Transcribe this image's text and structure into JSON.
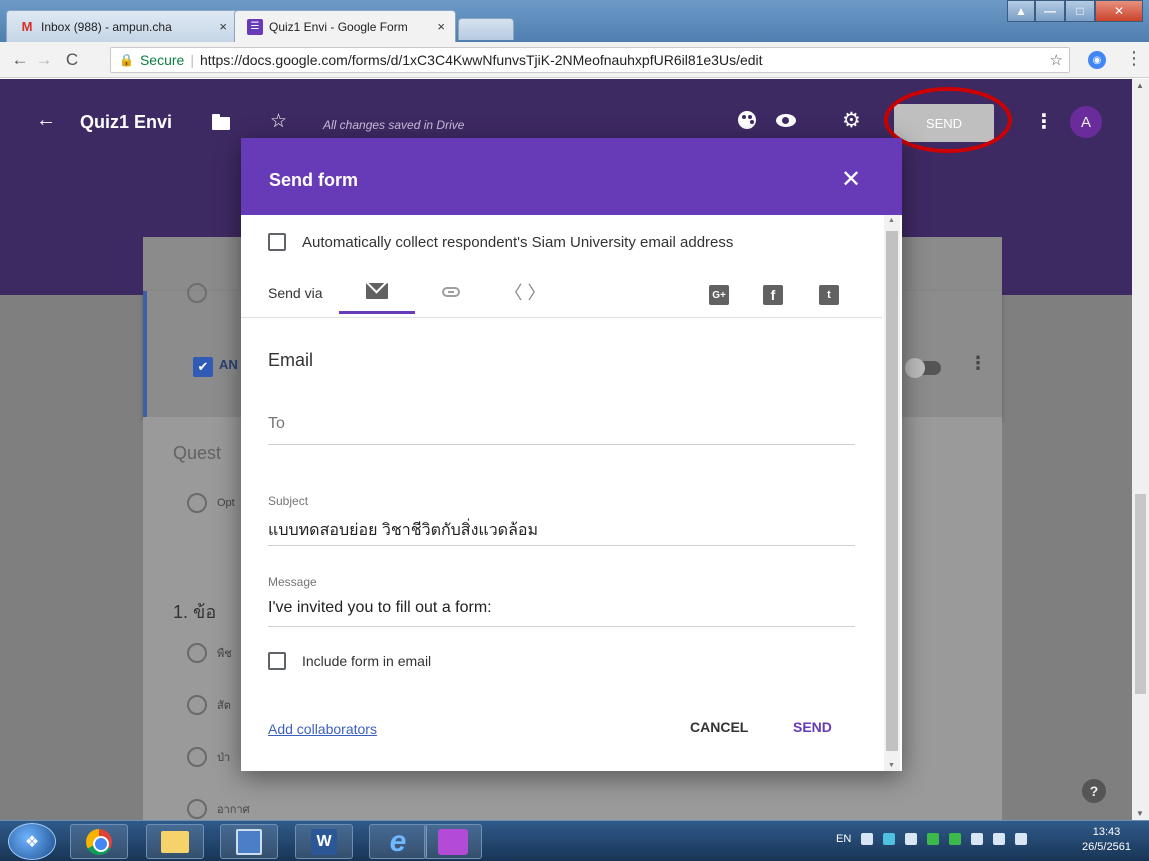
{
  "browser": {
    "tabs": [
      {
        "label": "Inbox (988) - ampun.cha",
        "icon": "gmail-icon",
        "close": "×"
      },
      {
        "label": "Quiz1 Envi - Google Form",
        "icon": "forms-icon",
        "close": "×"
      }
    ],
    "secure_label": "Secure",
    "url": "https://docs.google.com/forms/d/1xC3C4KwwNfunvsTjiK-2NMeofnauhxpfUR6il81e3Us/edit"
  },
  "forms_header": {
    "title": "Quiz1 Envi",
    "saved_status": "All changes saved in Drive",
    "send_label": "SEND",
    "avatar_letter": "A"
  },
  "background_form": {
    "answer_key_label": "AN",
    "question_placeholder": "Quest",
    "option_label": "Opt",
    "question_1": "1. ข้อ",
    "options": [
      "พืช",
      "สัต",
      "ป่า",
      "อากาศ"
    ]
  },
  "dialog": {
    "title": "Send form",
    "collect_email_label": "Automatically collect respondent's Siam University email address",
    "send_via_label": "Send via",
    "section_heading": "Email",
    "to_placeholder": "To",
    "subject_label": "Subject",
    "subject_value": "แบบทดสอบย่อย วิชาชีวิตกับสิ่งแวดล้อม",
    "message_label": "Message",
    "message_value": "I've invited you to fill out a form:",
    "include_form_label": "Include form in email",
    "add_collaborators": "Add collaborators",
    "cancel_label": "CANCEL",
    "send_label": "SEND"
  },
  "taskbar": {
    "lang": "EN",
    "time": "13:43",
    "date": "26/5/2561"
  },
  "colors": {
    "forms_purple": "#673ab7",
    "header_overlay": "#3e2a63",
    "highlight_circle": "#cc0000"
  }
}
